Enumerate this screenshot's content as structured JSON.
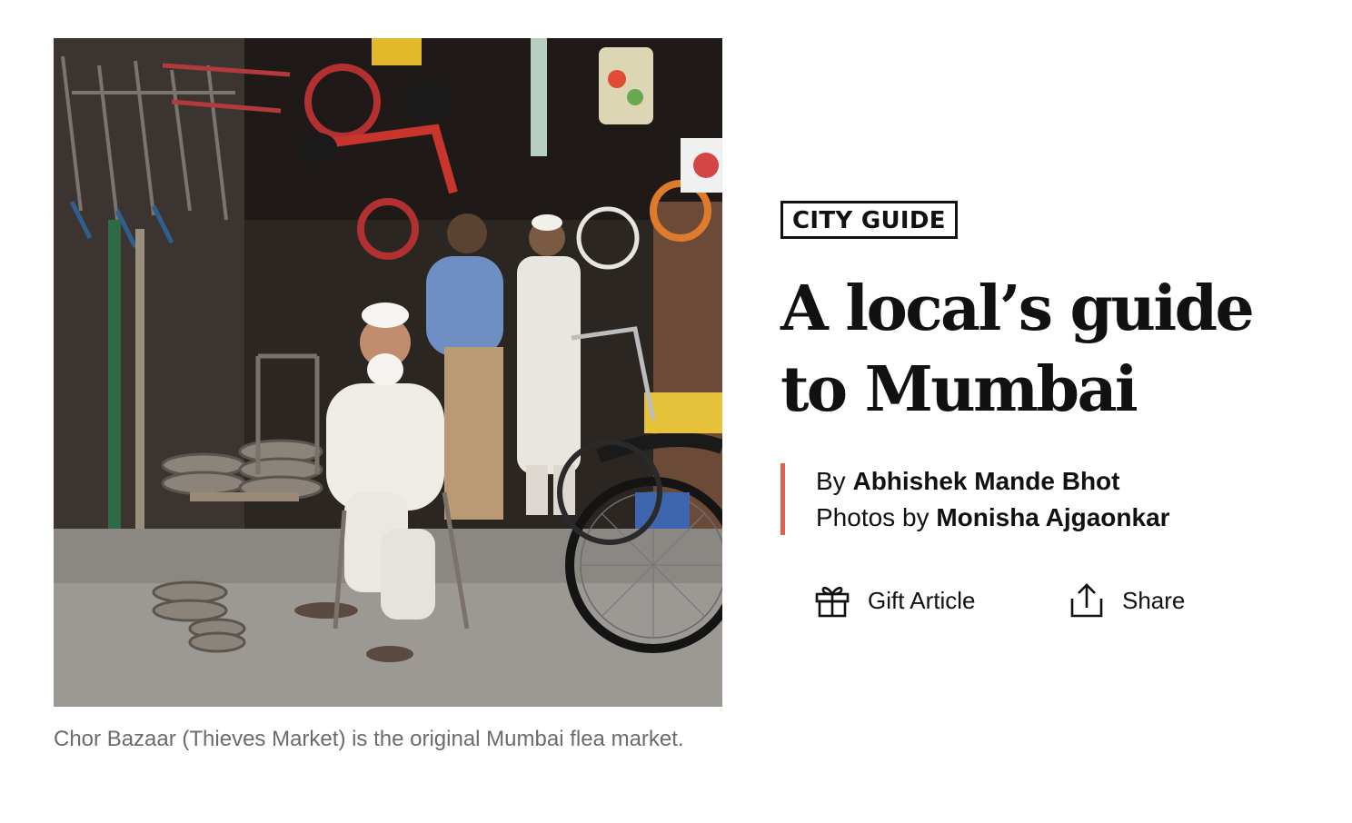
{
  "hero": {
    "image_alt": "Elderly man in white seated outside a crowded shop with bicycles and wheels hanging overhead",
    "caption": "Chor Bazaar (Thieves Market) is the original Mumbai flea market."
  },
  "article": {
    "kicker": "CITY GUIDE",
    "headline": "A local’s guide to Mumbai",
    "byline": {
      "by_prefix": "By ",
      "author": "Abhishek Mande Bhot",
      "photos_prefix": "Photos by ",
      "photographer": "Monisha Ajgaonkar"
    },
    "actions": {
      "gift_label": "Gift Article",
      "gift_icon": "gift-icon",
      "share_label": "Share",
      "share_icon": "share-icon"
    }
  },
  "colors": {
    "byline_rule": "#e0604a",
    "caption_text": "#6b6b6b",
    "text": "#111111"
  }
}
